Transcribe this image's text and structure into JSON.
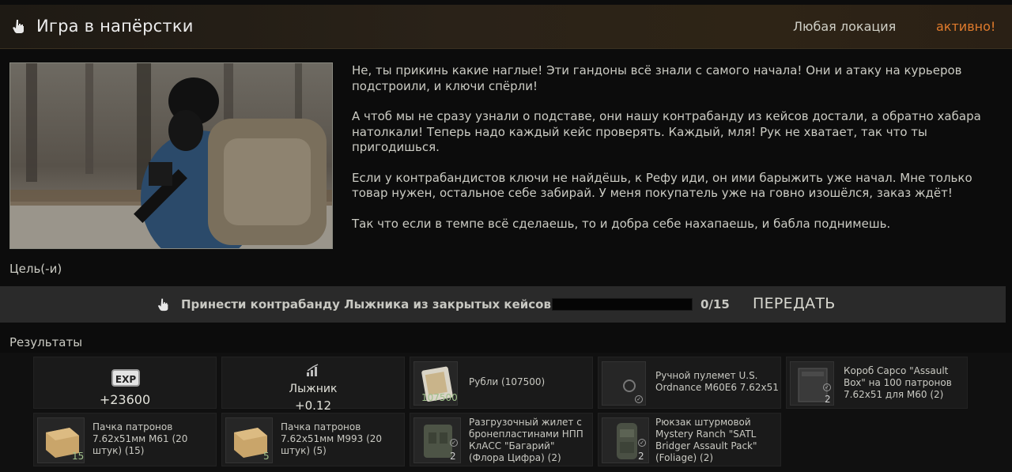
{
  "header": {
    "title": "Игра в напёрстки",
    "location": "Любая локация",
    "status": "активно!"
  },
  "description": [
    "Не, ты прикинь какие наглые! Эти гандоны всё знали с самого начала! Они и атаку на курьеров подстроили, и ключи спёрли!",
    "А чтоб мы не сразу узнали о подставе, они нашу контрабанду из кейсов достали, а обратно хабара натолкали! Теперь надо каждый кейс проверять. Каждый, мля! Рук не хватает, так что ты пригодишься.",
    "Если у контрабандистов ключи не найдёшь, к Рефу иди, он ими барыжить уже начал. Мне только товар нужен, остальное себе забирай. У меня покупатель уже на говно изошёлся, заказ ждёт!",
    "Так что если в темпе всё сделаешь, то и добра себе нахапаешь, и бабла поднимешь."
  ],
  "goals_label": "Цель(-и)",
  "objective": {
    "text": "Принести контрабанду Лыжника из закрытых кейсов",
    "progress_current": 0,
    "progress_total": 15,
    "progress_label": "0/15",
    "handover_label": "ПЕРЕДАТЬ"
  },
  "results_label": "Результаты",
  "rewards": {
    "exp": {
      "icon_label": "EXP",
      "value": "+23600"
    },
    "trader": {
      "name": "Лыжник",
      "value": "+0.12"
    },
    "items": [
      {
        "name": "Рубли (107500)",
        "count": "107500",
        "icon": "rubles-icon"
      },
      {
        "name": "Ручной пулемет U.S. Ordnance M60E6 7.62x51",
        "count": "",
        "icon": "machine-gun-icon"
      },
      {
        "name": "Короб Capco \"Assault Box\" на 100 патронов 7.62x51 для M60 (2)",
        "count": "2",
        "icon": "ammo-box-icon"
      },
      {
        "name": "Пачка патронов 7.62x51мм M61 (20 штук) (15)",
        "count": "15",
        "icon": "ammo-pack-icon"
      },
      {
        "name": "Пачка патронов 7.62x51мм M993 (20 штук) (5)",
        "count": "5",
        "icon": "ammo-pack-icon"
      },
      {
        "name": "Разгрузочный жилет с бронепластинами НПП КлАСС \"Багарий\" (Флора Цифра) (2)",
        "count": "2",
        "icon": "vest-icon"
      },
      {
        "name": "Рюкзак штурмовой Mystery Ranch \"SATL Bridger Assault Pack\" (Foliage) (2)",
        "count": "2",
        "icon": "backpack-icon"
      }
    ]
  }
}
